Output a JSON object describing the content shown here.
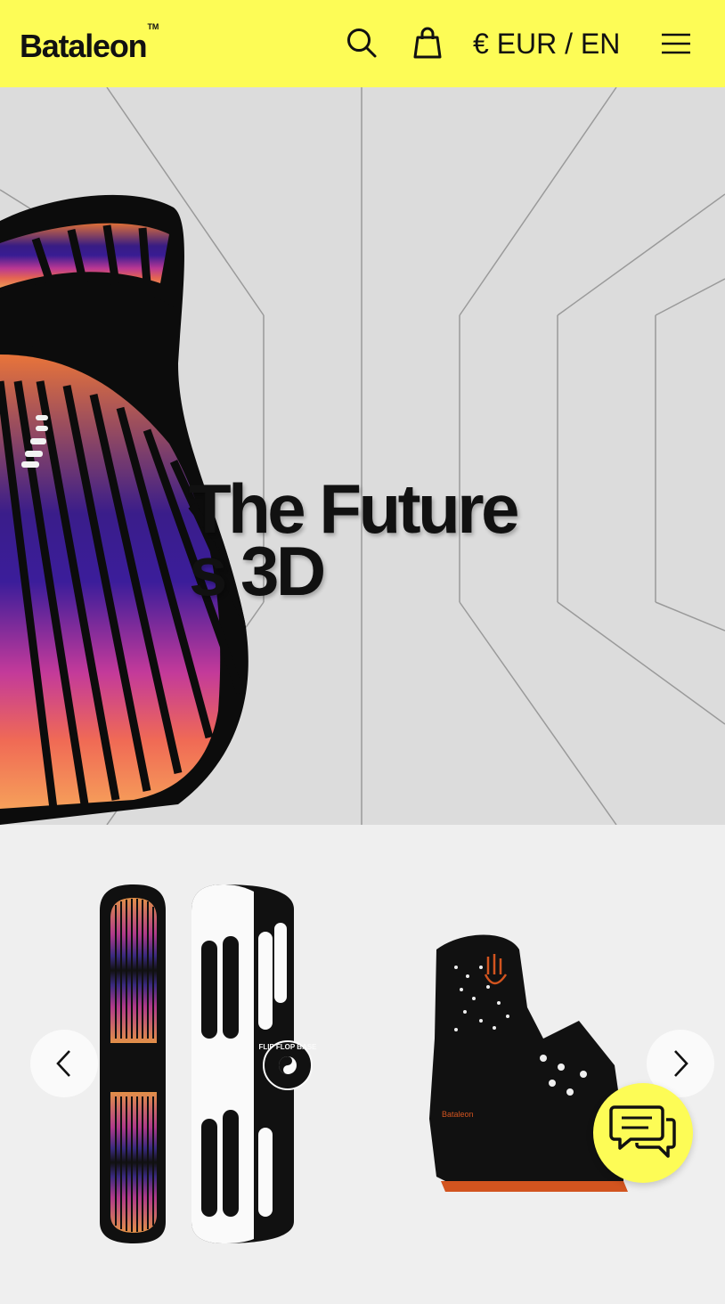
{
  "header": {
    "logo_text": "Bataleon",
    "logo_tm": "TM",
    "locale_label": "€ EUR / EN",
    "icons": [
      "search-icon",
      "shopping-bag-icon",
      "hamburger-menu-icon"
    ],
    "background_color": "#fdfc56"
  },
  "hero": {
    "title_line1": "The Future",
    "title_line2": "s 3D",
    "background_color": "#dcdcdc",
    "image": "3D snowboard with purple-to-orange striped base"
  },
  "products": {
    "items": [
      {
        "name": "snowboard",
        "image": "black snowboard with gradient stripes and white hands topsheet, Flip Flop Base badge",
        "badge_text": "FLIP FLOP BASE"
      },
      {
        "name": "binding",
        "image": "black Bataleon snowboard binding with orange accents",
        "logo_text": "Bataleon"
      }
    ],
    "prev_icon": "chevron-left-icon",
    "next_icon": "chevron-right-icon"
  },
  "chat": {
    "icon": "chat-bubbles-icon",
    "color": "#fdfc56"
  }
}
